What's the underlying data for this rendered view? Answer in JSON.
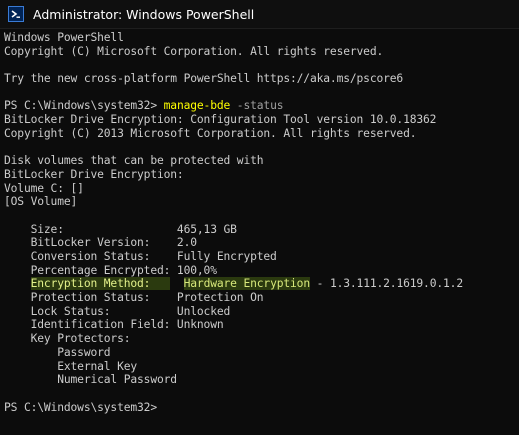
{
  "window": {
    "title": "Administrator: Windows PowerShell",
    "icon": "powershell-icon"
  },
  "console": {
    "lines": [
      {
        "text": "Windows PowerShell"
      },
      {
        "text": "Copyright (C) Microsoft Corporation. All rights reserved."
      },
      {
        "text": ""
      },
      {
        "text": "Try the new cross-platform PowerShell https://aka.ms/pscore6"
      },
      {
        "text": ""
      },
      {
        "prompt": "PS C:\\Windows\\system32> ",
        "command": "manage-bde",
        "param": " -status"
      },
      {
        "text": "BitLocker Drive Encryption: Configuration Tool version 10.0.18362"
      },
      {
        "text": "Copyright (C) 2013 Microsoft Corporation. All rights reserved."
      },
      {
        "text": ""
      },
      {
        "text": "Disk volumes that can be protected with"
      },
      {
        "text": "BitLocker Drive Encryption:"
      },
      {
        "text": "Volume C: []"
      },
      {
        "text": "[OS Volume]"
      },
      {
        "text": ""
      },
      {
        "text": "    Size:                 465,13 GB"
      },
      {
        "text": "    BitLocker Version:    2.0"
      },
      {
        "text": "    Conversion Status:    Fully Encrypted"
      },
      {
        "text": "    Percentage Encrypted: 100,0%"
      },
      {
        "indent": "    ",
        "hl_label": "Encryption Method:   ",
        "gap": "  ",
        "hl_value": "Hardware Encryption",
        "rest": " - 1.3.111.2.1619.0.1.2"
      },
      {
        "text": "    Protection Status:    Protection On"
      },
      {
        "text": "    Lock Status:          Unlocked"
      },
      {
        "text": "    Identification Field: Unknown"
      },
      {
        "text": "    Key Protectors:"
      },
      {
        "text": "        Password"
      },
      {
        "text": "        External Key"
      },
      {
        "text": "        Numerical Password"
      },
      {
        "text": ""
      },
      {
        "prompt": "PS C:\\Windows\\system32> ",
        "command": "",
        "param": ""
      }
    ]
  },
  "colors": {
    "background": "#0c0c0c",
    "text": "#cccccc",
    "command": "#ffff00",
    "parameter": "#a0a0a0",
    "highlight": "#2b3a0f"
  }
}
